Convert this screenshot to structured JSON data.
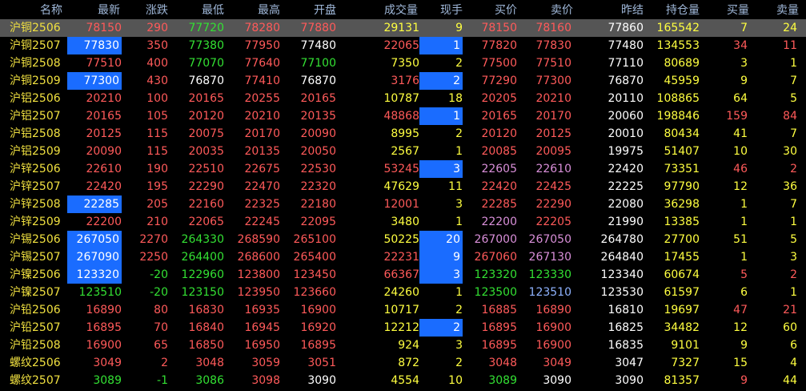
{
  "colors": {
    "background": "#000000",
    "up": "#ff5a5a",
    "down": "#33e033",
    "flat": "#ffffff",
    "name": "#f0e040",
    "volume": "#ffff40",
    "ask_side": "#ff8080",
    "bid_side_buy": "#ffffff",
    "highlight": "#1a6cff",
    "header": "#9fb7d8",
    "selected_row": "#555555",
    "magenta": "#d98fd9",
    "cyan": "#8fb3ff"
  },
  "columns": [
    "名称",
    "最新",
    "涨跌",
    "最低",
    "最高",
    "开盘",
    "成交量",
    "现手",
    "买价",
    "卖价",
    "昨结",
    "持仓量",
    "买量",
    "卖量"
  ],
  "rows": [
    {
      "name": "沪铜2506",
      "last": "78150",
      "chg": "290",
      "low": "77720",
      "high": "78280",
      "open": "77880",
      "vol": "29131",
      "cur": "9",
      "bid": "78150",
      "ask": "78160",
      "prev": "77860",
      "oi": "165542",
      "bq": "7",
      "aq": "24"
    },
    {
      "name": "沪铜2507",
      "last": "77830",
      "chg": "350",
      "low": "77380",
      "high": "77950",
      "open": "77480",
      "vol": "22065",
      "cur": "1",
      "bid": "77820",
      "ask": "77830",
      "prev": "77480",
      "oi": "134553",
      "bq": "34",
      "aq": "11"
    },
    {
      "name": "沪铜2508",
      "last": "77510",
      "chg": "400",
      "low": "77070",
      "high": "77640",
      "open": "77100",
      "vol": "7350",
      "cur": "2",
      "bid": "77500",
      "ask": "77510",
      "prev": "77110",
      "oi": "80689",
      "bq": "3",
      "aq": "1"
    },
    {
      "name": "沪铜2509",
      "last": "77300",
      "chg": "430",
      "low": "76870",
      "high": "77410",
      "open": "76870",
      "vol": "3176",
      "cur": "2",
      "bid": "77290",
      "ask": "77300",
      "prev": "76870",
      "oi": "45959",
      "bq": "9",
      "aq": "7"
    },
    {
      "name": "沪铝2506",
      "last": "20210",
      "chg": "100",
      "low": "20165",
      "high": "20255",
      "open": "20165",
      "vol": "10787",
      "cur": "18",
      "bid": "20205",
      "ask": "20210",
      "prev": "20110",
      "oi": "108865",
      "bq": "64",
      "aq": "5"
    },
    {
      "name": "沪铝2507",
      "last": "20165",
      "chg": "105",
      "low": "20120",
      "high": "20210",
      "open": "20135",
      "vol": "48868",
      "cur": "1",
      "bid": "20165",
      "ask": "20170",
      "prev": "20060",
      "oi": "198846",
      "bq": "159",
      "aq": "84"
    },
    {
      "name": "沪铝2508",
      "last": "20125",
      "chg": "115",
      "low": "20075",
      "high": "20170",
      "open": "20090",
      "vol": "8995",
      "cur": "2",
      "bid": "20120",
      "ask": "20125",
      "prev": "20010",
      "oi": "80434",
      "bq": "41",
      "aq": "7"
    },
    {
      "name": "沪铝2509",
      "last": "20090",
      "chg": "115",
      "low": "20035",
      "high": "20135",
      "open": "20050",
      "vol": "2567",
      "cur": "1",
      "bid": "20085",
      "ask": "20095",
      "prev": "19975",
      "oi": "51407",
      "bq": "10",
      "aq": "30"
    },
    {
      "name": "沪锌2506",
      "last": "22610",
      "chg": "190",
      "low": "22510",
      "high": "22675",
      "open": "22530",
      "vol": "53245",
      "cur": "3",
      "bid": "22605",
      "ask": "22610",
      "prev": "22420",
      "oi": "73351",
      "bq": "46",
      "aq": "2"
    },
    {
      "name": "沪锌2507",
      "last": "22420",
      "chg": "195",
      "low": "22290",
      "high": "22470",
      "open": "22320",
      "vol": "47629",
      "cur": "11",
      "bid": "22420",
      "ask": "22425",
      "prev": "22225",
      "oi": "97790",
      "bq": "12",
      "aq": "36"
    },
    {
      "name": "沪锌2508",
      "last": "22285",
      "chg": "205",
      "low": "22160",
      "high": "22325",
      "open": "22180",
      "vol": "12001",
      "cur": "3",
      "bid": "22285",
      "ask": "22290",
      "prev": "22080",
      "oi": "36298",
      "bq": "1",
      "aq": "7"
    },
    {
      "name": "沪锌2509",
      "last": "22200",
      "chg": "210",
      "low": "22065",
      "high": "22245",
      "open": "22095",
      "vol": "3480",
      "cur": "1",
      "bid": "22200",
      "ask": "22205",
      "prev": "21990",
      "oi": "13385",
      "bq": "1",
      "aq": "1"
    },
    {
      "name": "沪锡2506",
      "last": "267050",
      "chg": "2270",
      "low": "264330",
      "high": "268590",
      "open": "265100",
      "vol": "50225",
      "cur": "20",
      "bid": "267000",
      "ask": "267050",
      "prev": "264780",
      "oi": "27700",
      "bq": "51",
      "aq": "5"
    },
    {
      "name": "沪锡2507",
      "last": "267090",
      "chg": "2250",
      "low": "264400",
      "high": "268600",
      "open": "265400",
      "vol": "22231",
      "cur": "9",
      "bid": "267060",
      "ask": "267130",
      "prev": "264840",
      "oi": "17455",
      "bq": "1",
      "aq": "3"
    },
    {
      "name": "沪镍2506",
      "last": "123320",
      "chg": "-20",
      "low": "122960",
      "high": "123800",
      "open": "123450",
      "vol": "66367",
      "cur": "3",
      "bid": "123320",
      "ask": "123330",
      "prev": "123340",
      "oi": "60674",
      "bq": "5",
      "aq": "2"
    },
    {
      "name": "沪镍2507",
      "last": "123510",
      "chg": "-20",
      "low": "123150",
      "high": "123950",
      "open": "123660",
      "vol": "24260",
      "cur": "1",
      "bid": "123500",
      "ask": "123510",
      "prev": "123530",
      "oi": "61597",
      "bq": "6",
      "aq": "1"
    },
    {
      "name": "沪铅2506",
      "last": "16890",
      "chg": "80",
      "low": "16830",
      "high": "16935",
      "open": "16900",
      "vol": "10717",
      "cur": "2",
      "bid": "16885",
      "ask": "16890",
      "prev": "16810",
      "oi": "19697",
      "bq": "47",
      "aq": "21"
    },
    {
      "name": "沪铅2507",
      "last": "16895",
      "chg": "70",
      "low": "16840",
      "high": "16945",
      "open": "16920",
      "vol": "12212",
      "cur": "2",
      "bid": "16895",
      "ask": "16900",
      "prev": "16825",
      "oi": "34482",
      "bq": "12",
      "aq": "60"
    },
    {
      "name": "沪铅2508",
      "last": "16900",
      "chg": "65",
      "low": "16850",
      "high": "16950",
      "open": "16895",
      "vol": "924",
      "cur": "3",
      "bid": "16895",
      "ask": "16900",
      "prev": "16835",
      "oi": "9101",
      "bq": "9",
      "aq": "6"
    },
    {
      "name": "螺纹2506",
      "last": "3049",
      "chg": "2",
      "low": "3048",
      "high": "3059",
      "open": "3051",
      "vol": "872",
      "cur": "2",
      "bid": "3048",
      "ask": "3049",
      "prev": "3047",
      "oi": "7327",
      "bq": "15",
      "aq": "4"
    },
    {
      "name": "螺纹2507",
      "last": "3089",
      "chg": "-1",
      "low": "3086",
      "high": "3098",
      "open": "3090",
      "vol": "4554",
      "cur": "10",
      "bid": "3089",
      "ask": "3090",
      "prev": "3090",
      "oi": "81357",
      "bq": "9",
      "aq": "44"
    }
  ],
  "styles": [
    {
      "last": "up",
      "chg": "up",
      "low": "down",
      "high": "up",
      "open": "up",
      "vol": "volume",
      "cur": "volume",
      "bid": "up",
      "ask": "up",
      "prev": "flat",
      "oi": "volume",
      "bq": "volume",
      "aq": "volume",
      "sel": true
    },
    {
      "last": "hl",
      "chg": "up",
      "low": "down",
      "high": "up",
      "open": "flat",
      "vol": "up",
      "cur": "hl",
      "bid": "up",
      "ask": "up",
      "prev": "flat",
      "oi": "volume",
      "bq": "up",
      "aq": "up"
    },
    {
      "last": "up",
      "chg": "up",
      "low": "down",
      "high": "up",
      "open": "down",
      "vol": "volume",
      "cur": "volume",
      "bid": "up",
      "ask": "up",
      "prev": "flat",
      "oi": "volume",
      "bq": "volume",
      "aq": "volume"
    },
    {
      "last": "hl",
      "chg": "up",
      "low": "flat",
      "high": "up",
      "open": "flat",
      "vol": "up",
      "cur": "hl",
      "bid": "up",
      "ask": "up",
      "prev": "flat",
      "oi": "volume",
      "bq": "volume",
      "aq": "volume"
    },
    {
      "last": "up",
      "chg": "up",
      "low": "up",
      "high": "up",
      "open": "up",
      "vol": "volume",
      "cur": "volume",
      "bid": "up",
      "ask": "up",
      "prev": "flat",
      "oi": "volume",
      "bq": "volume",
      "aq": "volume"
    },
    {
      "last": "up",
      "chg": "up",
      "low": "up",
      "high": "up",
      "open": "up",
      "vol": "up",
      "cur": "hl",
      "bid": "up",
      "ask": "up",
      "prev": "flat",
      "oi": "volume",
      "bq": "up",
      "aq": "up"
    },
    {
      "last": "up",
      "chg": "up",
      "low": "up",
      "high": "up",
      "open": "up",
      "vol": "volume",
      "cur": "volume",
      "bid": "up",
      "ask": "up",
      "prev": "flat",
      "oi": "volume",
      "bq": "volume",
      "aq": "volume"
    },
    {
      "last": "up",
      "chg": "up",
      "low": "up",
      "high": "up",
      "open": "up",
      "vol": "volume",
      "cur": "volume",
      "bid": "up",
      "ask": "up",
      "prev": "flat",
      "oi": "volume",
      "bq": "volume",
      "aq": "volume"
    },
    {
      "last": "up",
      "chg": "up",
      "low": "up",
      "high": "up",
      "open": "up",
      "vol": "up",
      "cur": "hl",
      "bid": "magenta",
      "ask": "magenta",
      "prev": "flat",
      "oi": "volume",
      "bq": "up",
      "aq": "up"
    },
    {
      "last": "up",
      "chg": "up",
      "low": "up",
      "high": "up",
      "open": "up",
      "vol": "volume",
      "cur": "volume",
      "bid": "up",
      "ask": "up",
      "prev": "flat",
      "oi": "volume",
      "bq": "volume",
      "aq": "volume"
    },
    {
      "last": "hl",
      "chg": "up",
      "low": "up",
      "high": "up",
      "open": "up",
      "vol": "up",
      "cur": "volume",
      "bid": "up",
      "ask": "up",
      "prev": "flat",
      "oi": "volume",
      "bq": "volume",
      "aq": "volume"
    },
    {
      "last": "up",
      "chg": "up",
      "low": "up",
      "high": "up",
      "open": "up",
      "vol": "volume",
      "cur": "volume",
      "bid": "magenta",
      "ask": "up",
      "prev": "flat",
      "oi": "volume",
      "bq": "volume",
      "aq": "volume"
    },
    {
      "last": "hl",
      "chg": "up",
      "low": "down",
      "high": "up",
      "open": "up",
      "vol": "volume",
      "cur": "hl",
      "bid": "magenta",
      "ask": "magenta",
      "prev": "flat",
      "oi": "volume",
      "bq": "volume",
      "aq": "volume"
    },
    {
      "last": "hl",
      "chg": "up",
      "low": "down",
      "high": "up",
      "open": "up",
      "vol": "up",
      "cur": "hl",
      "bid": "up",
      "ask": "magenta",
      "prev": "flat",
      "oi": "volume",
      "bq": "volume",
      "aq": "volume"
    },
    {
      "last": "hl",
      "chg": "down",
      "low": "down",
      "high": "up",
      "open": "up",
      "vol": "up",
      "cur": "hl",
      "bid": "down",
      "ask": "down",
      "prev": "flat",
      "oi": "volume",
      "bq": "up",
      "aq": "up"
    },
    {
      "last": "down",
      "chg": "down",
      "low": "down",
      "high": "up",
      "open": "up",
      "vol": "volume",
      "cur": "volume",
      "bid": "down",
      "ask": "cyan",
      "prev": "flat",
      "oi": "volume",
      "bq": "volume",
      "aq": "volume"
    },
    {
      "last": "up",
      "chg": "up",
      "low": "up",
      "high": "up",
      "open": "up",
      "vol": "volume",
      "cur": "volume",
      "bid": "up",
      "ask": "up",
      "prev": "flat",
      "oi": "volume",
      "bq": "up",
      "aq": "up"
    },
    {
      "last": "up",
      "chg": "up",
      "low": "up",
      "high": "up",
      "open": "up",
      "vol": "volume",
      "cur": "hl",
      "bid": "up",
      "ask": "up",
      "prev": "flat",
      "oi": "volume",
      "bq": "volume",
      "aq": "volume"
    },
    {
      "last": "up",
      "chg": "up",
      "low": "up",
      "high": "up",
      "open": "up",
      "vol": "volume",
      "cur": "volume",
      "bid": "up",
      "ask": "up",
      "prev": "flat",
      "oi": "volume",
      "bq": "volume",
      "aq": "volume"
    },
    {
      "last": "up",
      "chg": "up",
      "low": "up",
      "high": "up",
      "open": "up",
      "vol": "volume",
      "cur": "volume",
      "bid": "up",
      "ask": "up",
      "prev": "flat",
      "oi": "volume",
      "bq": "volume",
      "aq": "volume"
    },
    {
      "last": "down",
      "chg": "down",
      "low": "down",
      "high": "up",
      "open": "flat",
      "vol": "volume",
      "cur": "volume",
      "bid": "down",
      "ask": "flat",
      "prev": "flat",
      "oi": "volume",
      "bq": "up",
      "aq": "volume"
    }
  ]
}
